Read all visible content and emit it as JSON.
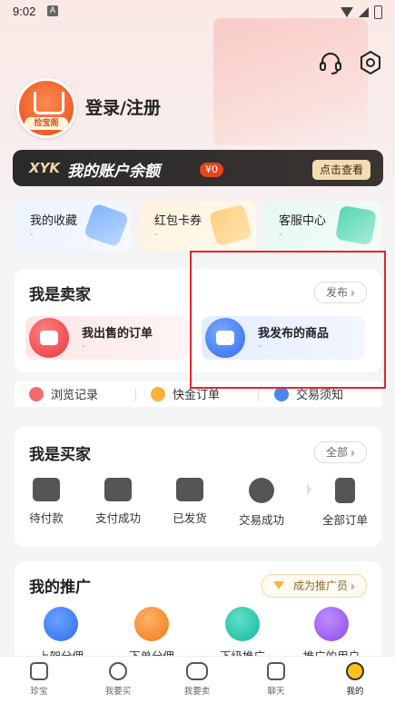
{
  "status": {
    "time": "9:02",
    "notif": "A"
  },
  "header": {
    "login_label": "登录/注册",
    "avatar_tag": "捡宝阁"
  },
  "balance": {
    "brand": "XYK",
    "title": "我的账户余额",
    "amount": "¥0",
    "view_label": "点击查看"
  },
  "quick": [
    {
      "label": "我的收藏",
      "sub": "-"
    },
    {
      "label": "红包卡券",
      "sub": "-"
    },
    {
      "label": "客服中心",
      "sub": "-"
    }
  ],
  "seller": {
    "title": "我是卖家",
    "publish_label": "发布",
    "tiles": [
      {
        "label": "我出售的订单",
        "sub": "-"
      },
      {
        "label": "我发布的商品",
        "sub": "-"
      }
    ]
  },
  "links": [
    {
      "label": "浏览记录"
    },
    {
      "label": "快金订单"
    },
    {
      "label": "交易须知"
    }
  ],
  "buyer": {
    "title": "我是买家",
    "all_label": "全部",
    "items": [
      {
        "label": "待付款"
      },
      {
        "label": "支付成功"
      },
      {
        "label": "已发货"
      },
      {
        "label": "交易成功"
      },
      {
        "label": "全部订单"
      }
    ]
  },
  "promo": {
    "title": "我的推广",
    "become_label": "成为推广员",
    "items": [
      {
        "label": "上架分佣"
      },
      {
        "label": "下单分佣"
      },
      {
        "label": "下级推广"
      },
      {
        "label": "推广的用户"
      }
    ]
  },
  "tabs": [
    {
      "label": "珍宝"
    },
    {
      "label": "我要买"
    },
    {
      "label": "我要卖"
    },
    {
      "label": "聊天"
    },
    {
      "label": "我的"
    }
  ],
  "colors": {
    "accent": "#e8421e",
    "highlight": "#e3262c",
    "active_tab": "#ffc21a"
  }
}
